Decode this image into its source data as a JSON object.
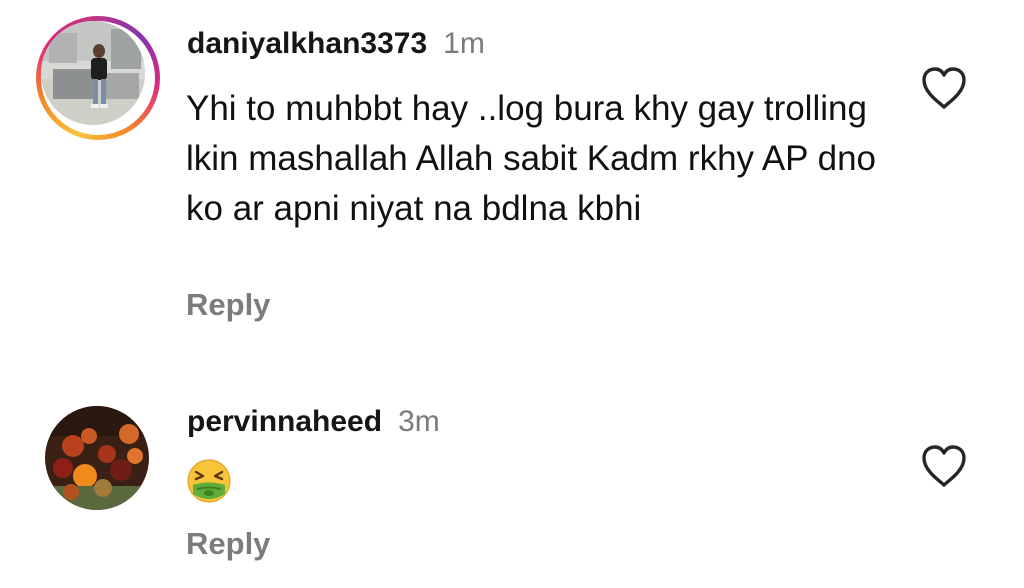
{
  "comments": [
    {
      "username": "daniyalkhan3373",
      "time": "1m",
      "text": "Yhi to muhbbt hay ..log bura khy gay trolling lkin mashallah Allah sabit Kadm rkhy AP dno ko ar apni niyat na bdlna kbhi",
      "reply_label": "Reply",
      "like_icon": "heart-outline-icon",
      "avatar_has_story_ring": true
    },
    {
      "username": "pervinnaheed",
      "time": "3m",
      "emoji": "nauseated-face-emoji",
      "reply_label": "Reply",
      "like_icon": "heart-outline-icon",
      "avatar_has_story_ring": false
    }
  ],
  "colors": {
    "text": "#111111",
    "muted": "#7a7a7a",
    "story_ring": [
      "#f9c33d",
      "#f58529",
      "#dd2a7b",
      "#8134af"
    ]
  }
}
